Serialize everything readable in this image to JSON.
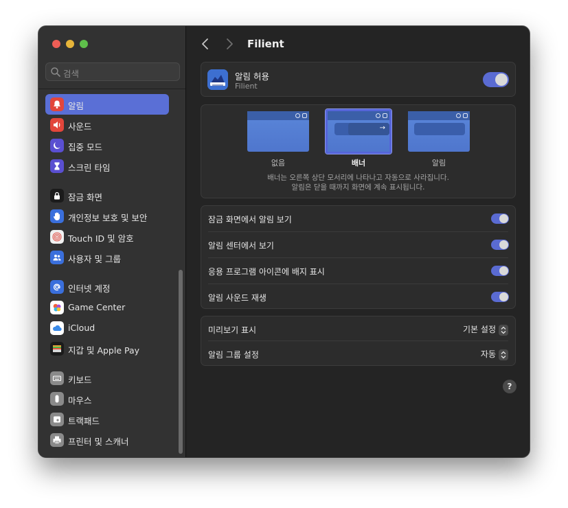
{
  "window": {
    "title": "Filient"
  },
  "sidebar": {
    "search_placeholder": "검색",
    "items": [
      {
        "label": "알림",
        "icon": "bell-icon",
        "color": "#e2463b",
        "active": true
      },
      {
        "label": "사운드",
        "icon": "speaker-icon",
        "color": "#e2463b"
      },
      {
        "label": "집중 모드",
        "icon": "moon-icon",
        "color": "#5a4fd1"
      },
      {
        "label": "스크린 타임",
        "icon": "hourglass-icon",
        "color": "#5a4fd1"
      },
      {
        "label": "잠금 화면",
        "icon": "lock-icon",
        "color": "#1b1b1b"
      },
      {
        "label": "개인정보 보호 및 보안",
        "icon": "hand-icon",
        "color": "#3a6fdc"
      },
      {
        "label": "Touch ID 및 암호",
        "icon": "fingerprint-icon",
        "color": "#f0f0f0"
      },
      {
        "label": "사용자 및 그룹",
        "icon": "users-icon",
        "color": "#3a6fdc"
      },
      {
        "label": "인터넷 계정",
        "icon": "at-icon",
        "color": "#3a6fdc"
      },
      {
        "label": "Game Center",
        "icon": "game-center-icon",
        "color": "#ffffff"
      },
      {
        "label": "iCloud",
        "icon": "cloud-icon",
        "color": "#ffffff"
      },
      {
        "label": "지갑 및 Apple Pay",
        "icon": "wallet-icon",
        "color": "#1b1b1b"
      },
      {
        "label": "키보드",
        "icon": "keyboard-icon",
        "color": "#8a8a8a"
      },
      {
        "label": "마우스",
        "icon": "mouse-icon",
        "color": "#8a8a8a"
      },
      {
        "label": "트랙패드",
        "icon": "trackpad-icon",
        "color": "#8a8a8a"
      },
      {
        "label": "프린터 및 스캐너",
        "icon": "printer-icon",
        "color": "#8a8a8a"
      }
    ]
  },
  "app": {
    "allow_label": "알림 허용",
    "name": "Filient",
    "allow_on": true
  },
  "styles": {
    "options": [
      "없음",
      "배너",
      "알림"
    ],
    "selected": "배너",
    "description_line1": "배너는 오른쪽 상단 모서리에 나타나고 자동으로 사라집니다.",
    "description_line2": "알림은 닫을 때까지 화면에 계속 표시됩니다."
  },
  "toggles": [
    {
      "label": "잠금 화면에서 알림 보기",
      "on": true
    },
    {
      "label": "알림 센터에서 보기",
      "on": true
    },
    {
      "label": "응용 프로그램 아이콘에 배지 표시",
      "on": true
    },
    {
      "label": "알림 사운드 재생",
      "on": true
    }
  ],
  "popups": [
    {
      "label": "미리보기 표시",
      "value": "기본 설정"
    },
    {
      "label": "알림 그룹 설정",
      "value": "자동"
    }
  ],
  "help_label": "?",
  "accent": "#5a6bd2"
}
